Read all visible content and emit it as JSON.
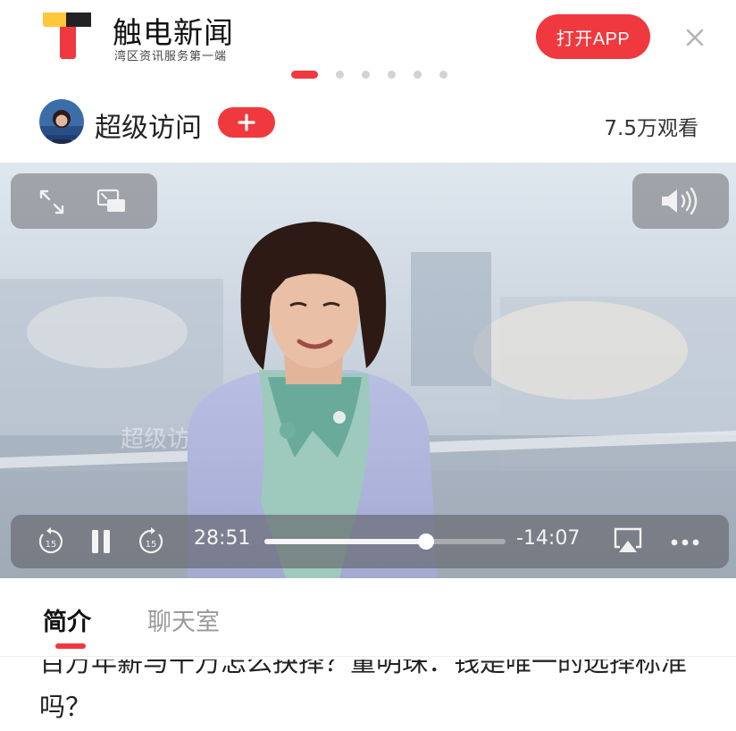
{
  "app": {
    "name": "触电新闻",
    "slogan": "湾区资讯服务第一端",
    "open_app_label": "打开APP",
    "brand_color": "#f0393e"
  },
  "carousel": {
    "total": 6,
    "active_index": 0
  },
  "channel": {
    "name": "超级访问",
    "follow_icon": "plus-icon",
    "views": "7.5万观看"
  },
  "video": {
    "watermark": "超级访问",
    "elapsed": "28:51",
    "remaining": "-14:07",
    "progress": 0.67,
    "skip_back_seconds": "15",
    "skip_forward_seconds": "15",
    "icons": [
      "expand-icon",
      "picture-in-picture-icon",
      "volume-icon",
      "pause-icon",
      "airplay-icon",
      "more-icon"
    ]
  },
  "tabs": [
    {
      "label": "简介",
      "active": true
    },
    {
      "label": "聊天室",
      "active": false
    }
  ],
  "article": {
    "title": "百万年薪与千万怎么抉择？董明珠：钱是唯一的选择标准吗？"
  }
}
